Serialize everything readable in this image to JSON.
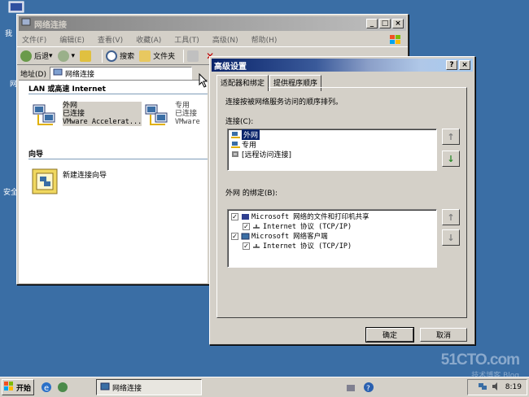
{
  "desktop": {
    "frag1": "我",
    "frag2": "网",
    "frag3": "安全"
  },
  "explorer": {
    "title": "网络连接",
    "menu": [
      "文件(F)",
      "编辑(E)",
      "查看(V)",
      "收藏(A)",
      "工具(T)",
      "高级(N)",
      "帮助(H)"
    ],
    "toolbar": {
      "back": "后退",
      "search": "搜索",
      "folders": "文件夹"
    },
    "address_label": "地址(D)",
    "address_value": "网络连接",
    "group_lan": "LAN 或高速 Internet",
    "group_wizard": "向导",
    "connections": [
      {
        "name": "外网",
        "status": "已连接",
        "device": "VMware Accelerat..."
      },
      {
        "name": "专用",
        "status": "已连接",
        "device": "VMware"
      }
    ],
    "wizard_item": "新建连接向导"
  },
  "dialog": {
    "title": "高级设置",
    "tabs": [
      "适配器和绑定",
      "提供程序顺序"
    ],
    "description": "连接按被网络服务访问的顺序排列。",
    "connections_label": "连接(C):",
    "connections_list": [
      "外网",
      "专用",
      "[远程访问连接]"
    ],
    "bindings_label": "外网 的绑定(B):",
    "bindings": [
      {
        "text": "Microsoft 网络的文件和打印机共享",
        "checked": true,
        "level": 0
      },
      {
        "text": "Internet 协议 (TCP/IP)",
        "checked": true,
        "level": 1
      },
      {
        "text": "Microsoft 网络客户端",
        "checked": true,
        "level": 0
      },
      {
        "text": "Internet 协议 (TCP/IP)",
        "checked": true,
        "level": 1
      }
    ],
    "ok": "确定",
    "cancel": "取消"
  },
  "taskbar": {
    "start": "开始",
    "task": "网络连接",
    "clock": "8:19"
  },
  "watermark": {
    "site": "51CTO.com",
    "sub": "技术博客 Blog"
  },
  "colors": {
    "desktop": "#3a6ea5",
    "title_active": "#0a246a",
    "selection": "#0a246a"
  }
}
